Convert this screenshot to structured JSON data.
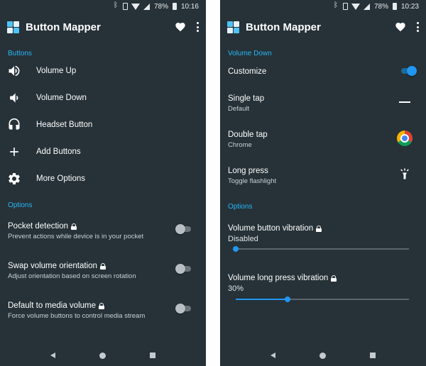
{
  "left": {
    "status": {
      "battery": "78%",
      "time": "10:16"
    },
    "app_title": "Button Mapper",
    "buttons_header": "Buttons",
    "buttons": [
      {
        "label": "Volume Up",
        "icon": "volume-up-icon"
      },
      {
        "label": "Volume Down",
        "icon": "volume-down-icon"
      },
      {
        "label": "Headset Button",
        "icon": "headset-icon"
      },
      {
        "label": "Add Buttons",
        "icon": "plus-icon"
      },
      {
        "label": "More Options",
        "icon": "gear-icon"
      }
    ],
    "options_header": "Options",
    "options": [
      {
        "title": "Pocket detection",
        "subtitle": "Prevent actions while device is in your pocket",
        "enabled": false,
        "locked": true
      },
      {
        "title": "Swap volume orientation",
        "subtitle": "Adjust orientation based on screen rotation",
        "enabled": false,
        "locked": true
      },
      {
        "title": "Default to media volume",
        "subtitle": "Force volume buttons to control media stream",
        "enabled": false,
        "locked": true
      }
    ]
  },
  "right": {
    "status": {
      "battery": "78%",
      "time": "10:23"
    },
    "app_title": "Button Mapper",
    "section_header": "Volume Down",
    "customize": {
      "label": "Customize",
      "enabled": true
    },
    "actions": [
      {
        "title": "Single tap",
        "subtitle": "Default",
        "icon": "dash-icon"
      },
      {
        "title": "Double tap",
        "subtitle": "Chrome",
        "icon": "chrome-icon"
      },
      {
        "title": "Long press",
        "subtitle": "Toggle flashlight",
        "icon": "flashlight-icon"
      }
    ],
    "options_header": "Options",
    "sliders": [
      {
        "title": "Volume button vibration",
        "value_label": "Disabled",
        "fraction": 0.0,
        "locked": true
      },
      {
        "title": "Volume long press vibration",
        "value_label": "30%",
        "fraction": 0.3,
        "locked": true
      }
    ]
  },
  "colors": {
    "background": "#263238",
    "accent": "#29b6f6",
    "switch_on": "#2196f3"
  }
}
